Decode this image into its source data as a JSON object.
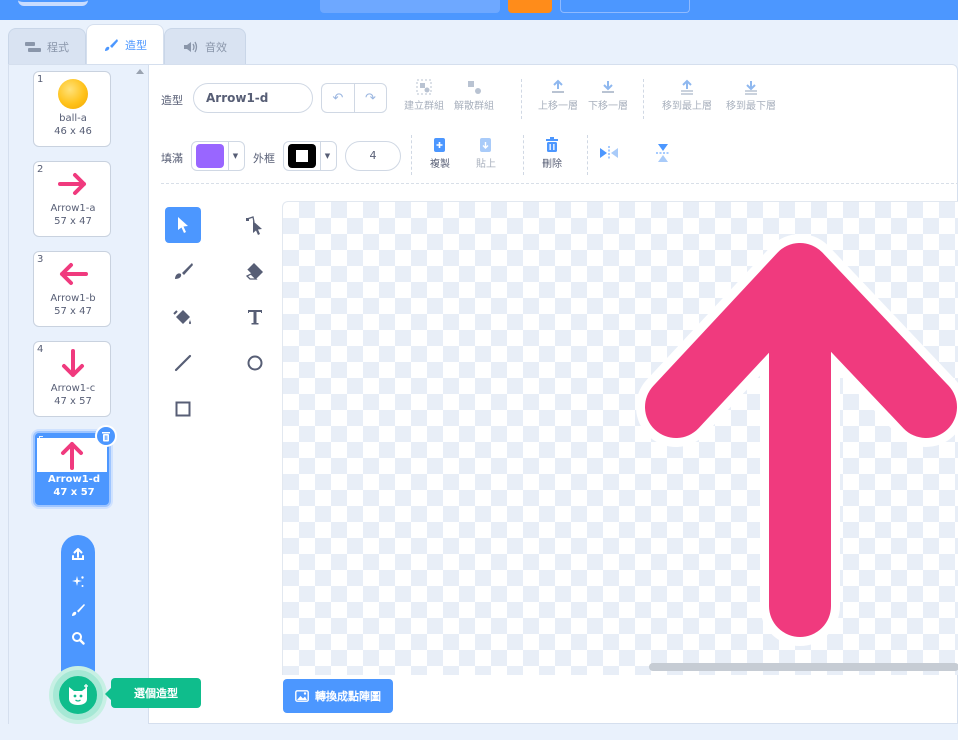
{
  "tabs": {
    "code": "程式",
    "costumes": "造型",
    "sounds": "音效"
  },
  "costumes": [
    {
      "num": "1",
      "name": "ball-a",
      "size": "46 x 46",
      "icon": "ball-icon"
    },
    {
      "num": "2",
      "name": "Arrow1-a",
      "size": "57 x 47",
      "icon": "arrow-right-icon"
    },
    {
      "num": "3",
      "name": "Arrow1-b",
      "size": "57 x 47",
      "icon": "arrow-left-icon"
    },
    {
      "num": "4",
      "name": "Arrow1-c",
      "size": "47 x 57",
      "icon": "arrow-down-icon"
    },
    {
      "num": "5",
      "name": "Arrow1-d",
      "size": "47 x 57",
      "icon": "arrow-up-icon",
      "selected": true
    }
  ],
  "tooltip": "選個造型",
  "editor": {
    "costume_label": "造型",
    "costume_name": "Arrow1-d",
    "fill_label": "填滿",
    "outline_label": "外框",
    "outline_width": "4",
    "fill_color": "#9966ff",
    "outline_color": "#000000",
    "arrow_color": "#f03a7e",
    "toolbar": {
      "group": "建立群組",
      "ungroup": "解散群組",
      "forward": "上移一層",
      "backward": "下移一層",
      "front": "移到最上層",
      "back": "移到最下層",
      "copy": "複製",
      "paste": "貼上",
      "delete": "刪除"
    },
    "convert_button": "轉換成點陣圖"
  },
  "colors": {
    "accent": "#4c97ff",
    "green": "#0fbd8c"
  }
}
